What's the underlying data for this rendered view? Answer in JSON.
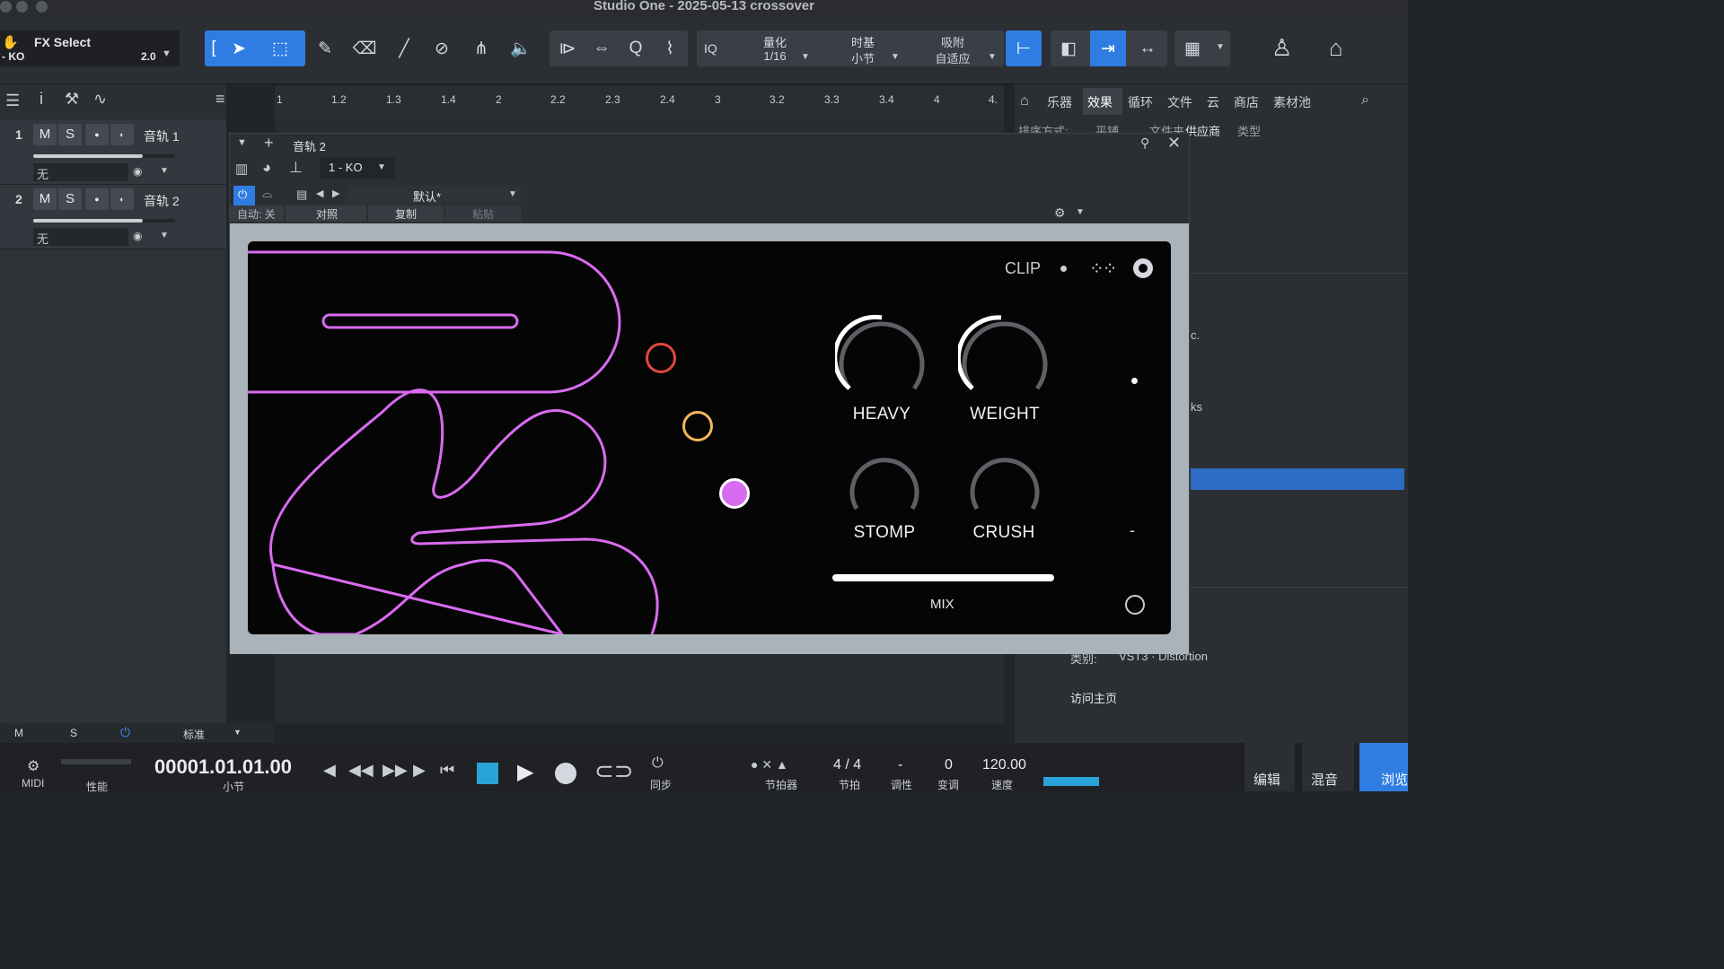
{
  "window": {
    "title": "Studio One - 2025-05-13 crossover"
  },
  "toolbar": {
    "fx_select": {
      "label": "FX Select",
      "sub": "- KO",
      "value": "2.0"
    },
    "quantize": {
      "label": "量化",
      "value": "1/16"
    },
    "timebase": {
      "label": "时基",
      "value": "小节"
    },
    "snap": {
      "label": "吸附",
      "value": "自适应"
    },
    "iq_label": "IQ"
  },
  "tracks": [
    {
      "num": "1",
      "m": "M",
      "s": "S",
      "name": "音轨 1",
      "input": "无"
    },
    {
      "num": "2",
      "m": "M",
      "s": "S",
      "name": "音轨 2",
      "input": "无"
    }
  ],
  "ruler": {
    "ticks": [
      "1",
      "1.2",
      "1.3",
      "1.4",
      "2",
      "2.2",
      "2.3",
      "2.4",
      "3",
      "3.2",
      "3.3",
      "3.4",
      "4",
      "4."
    ]
  },
  "browser": {
    "tabs": [
      "乐器",
      "效果",
      "循环",
      "文件",
      "云",
      "商店",
      "素材池"
    ],
    "sort_label": "排序方式:",
    "sort_options": [
      "平铺",
      "文件夹",
      "供应商",
      "类型"
    ],
    "category_label": "类别:",
    "category_value": "VST3 · Distortion",
    "visit_label": "访问主页",
    "partial_text_1": "c.",
    "partial_text_2": "ks"
  },
  "plugin_window": {
    "track": "音轨 2",
    "device": "1 - KO",
    "preset": "默认*",
    "auto_label": "自动: 关",
    "compare_label": "对照",
    "copy_label": "复制",
    "paste_label": "粘贴"
  },
  "plugin": {
    "clip_label": "CLIP",
    "knobs": [
      {
        "label": "HEAVY",
        "value": 0.65
      },
      {
        "label": "WEIGHT",
        "value": 0.58
      },
      {
        "label": "STOMP",
        "value": 0
      },
      {
        "label": "CRUSH",
        "value": 0
      }
    ],
    "mix_label": "MIX",
    "mix_value": 1.0,
    "minus_label": "-",
    "dot_colors": [
      "#e0473f",
      "#f2b65d",
      "#d96bf0"
    ],
    "accent": "#d96bf0"
  },
  "footer": {
    "m": "M",
    "s": "S",
    "standard": "标准"
  },
  "transport": {
    "midi_label": "MIDI",
    "perf_label": "性能",
    "position": "00001.01.01.00",
    "position_unit": "小节",
    "sync_label": "同步",
    "metronome_label": "节拍器",
    "signature": "4 / 4",
    "signature_label": "节拍",
    "key": "-",
    "key_label": "调性",
    "transpose": "0",
    "transpose_label": "变调",
    "tempo": "120.00",
    "tempo_label": "速度",
    "edit_tab": "编辑",
    "mix_tab": "混音",
    "browse_tab": "浏览"
  }
}
